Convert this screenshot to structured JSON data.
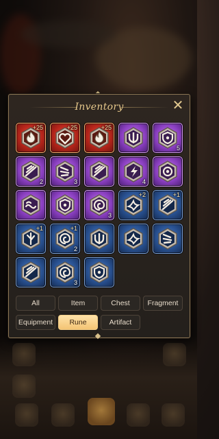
{
  "panel": {
    "title": "Inventory",
    "close_icon": "close-icon"
  },
  "items": [
    {
      "rarity": "red",
      "icon": "flame-rune-icon",
      "plus": "+25",
      "qty": ""
    },
    {
      "rarity": "red",
      "icon": "heart-rune-icon",
      "plus": "+25",
      "qty": ""
    },
    {
      "rarity": "red",
      "icon": "flame-rune-icon",
      "plus": "+25",
      "qty": ""
    },
    {
      "rarity": "purple",
      "icon": "trident-rune-icon",
      "plus": "",
      "qty": ""
    },
    {
      "rarity": "purple",
      "icon": "shield-rune-icon",
      "plus": "",
      "qty": "5"
    },
    {
      "rarity": "purple",
      "icon": "wing-rune-icon",
      "plus": "",
      "qty": "2"
    },
    {
      "rarity": "purple",
      "icon": "claw-rune-icon",
      "plus": "",
      "qty": "3"
    },
    {
      "rarity": "purple",
      "icon": "wing-rune-icon",
      "plus": "",
      "qty": ""
    },
    {
      "rarity": "purple",
      "icon": "bolt-rune-icon",
      "plus": "",
      "qty": "4"
    },
    {
      "rarity": "purple",
      "icon": "eye-rune-icon",
      "plus": "",
      "qty": ""
    },
    {
      "rarity": "purple",
      "icon": "wave-rune-icon",
      "plus": "",
      "qty": ""
    },
    {
      "rarity": "purple",
      "icon": "shield-rune-icon",
      "plus": "",
      "qty": ""
    },
    {
      "rarity": "purple",
      "icon": "swirl-rune-icon",
      "plus": "",
      "qty": "3"
    },
    {
      "rarity": "blue",
      "icon": "bird-rune-icon",
      "plus": "+2",
      "qty": ""
    },
    {
      "rarity": "blue",
      "icon": "wing-rune-icon",
      "plus": "+1",
      "qty": ""
    },
    {
      "rarity": "blue",
      "icon": "leaf-rune-icon",
      "plus": "+1",
      "qty": ""
    },
    {
      "rarity": "blue",
      "icon": "swirl-rune-icon",
      "plus": "+1",
      "qty": "2"
    },
    {
      "rarity": "blue",
      "icon": "trident-rune-icon",
      "plus": "",
      "qty": ""
    },
    {
      "rarity": "blue",
      "icon": "bird-rune-icon",
      "plus": "",
      "qty": ""
    },
    {
      "rarity": "blue",
      "icon": "claw-rune-icon",
      "plus": "",
      "qty": ""
    },
    {
      "rarity": "blue",
      "icon": "wing-rune-icon",
      "plus": "",
      "qty": ""
    },
    {
      "rarity": "blue",
      "icon": "swirl-rune-icon",
      "plus": "",
      "qty": "3"
    },
    {
      "rarity": "blue",
      "icon": "shield-rune-icon",
      "plus": "",
      "qty": ""
    }
  ],
  "tabs": [
    {
      "label": "All",
      "active": false
    },
    {
      "label": "Item",
      "active": false
    },
    {
      "label": "Chest",
      "active": false
    },
    {
      "label": "Fragment",
      "active": false
    },
    {
      "label": "Equipment",
      "active": false
    },
    {
      "label": "Rune",
      "active": true
    },
    {
      "label": "Artifact",
      "active": false
    }
  ],
  "colors": {
    "accent": "#f3c474",
    "frame": "#8c7654",
    "title": "#e7c98c"
  }
}
